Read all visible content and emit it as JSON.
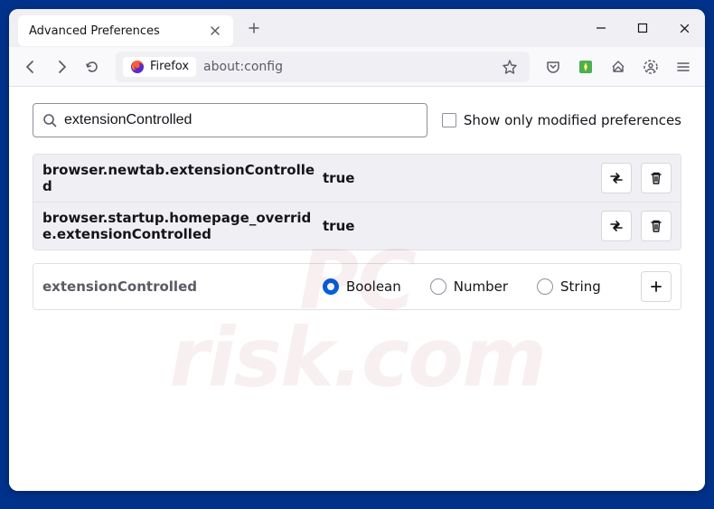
{
  "window": {
    "tab_title": "Advanced Preferences",
    "identity_label": "Firefox",
    "url": "about:config"
  },
  "search": {
    "value": "extensionControlled",
    "checkbox_label": "Show only modified preferences"
  },
  "prefs": [
    {
      "name": "browser.newtab.extensionControlled",
      "value": "true"
    },
    {
      "name": "browser.startup.homepage_override.extensionControlled",
      "value": "true"
    }
  ],
  "new_pref": {
    "name": "extensionControlled",
    "types": [
      "Boolean",
      "Number",
      "String"
    ],
    "selected": "Boolean"
  },
  "watermark": {
    "line1": "PC",
    "line2": "risk.com"
  }
}
